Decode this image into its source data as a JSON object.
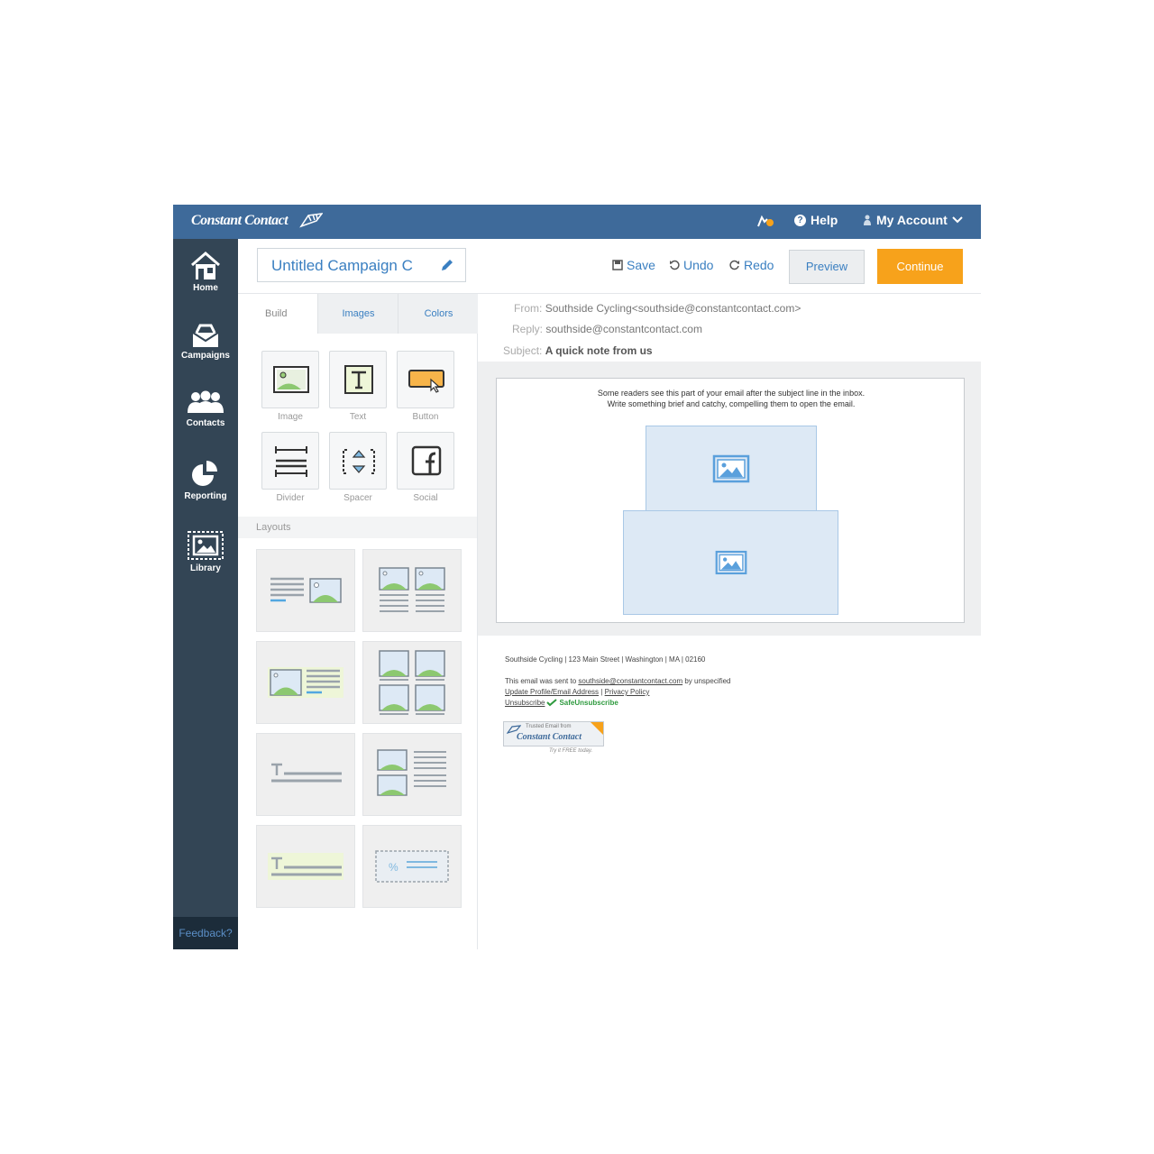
{
  "brand": {
    "name": "Constant Contact",
    "topbar_color": "#3e6a9a",
    "sidebar_color": "#334555",
    "accent": "#f7a21b",
    "link": "#3a7fc1"
  },
  "topbar": {
    "help_label": "Help",
    "account_label": "My Account"
  },
  "sidebar": {
    "items": [
      {
        "label": "Home",
        "icon": "home-icon"
      },
      {
        "label": "Campaigns",
        "icon": "campaigns-icon"
      },
      {
        "label": "Contacts",
        "icon": "contacts-icon"
      },
      {
        "label": "Reporting",
        "icon": "reporting-icon"
      },
      {
        "label": "Library",
        "icon": "library-icon"
      }
    ],
    "feedback_label": "Feedback?"
  },
  "editor": {
    "campaign_title": "Untitled Campaign C",
    "save_label": "Save",
    "undo_label": "Undo",
    "redo_label": "Redo",
    "preview_label": "Preview",
    "continue_label": "Continue"
  },
  "panel": {
    "tabs": [
      {
        "label": "Build"
      },
      {
        "label": "Images"
      },
      {
        "label": "Colors"
      }
    ],
    "blocks": [
      {
        "label": "Image",
        "icon": "image-block-icon"
      },
      {
        "label": "Text",
        "icon": "text-block-icon"
      },
      {
        "label": "Button",
        "icon": "button-block-icon"
      },
      {
        "label": "Divider",
        "icon": "divider-block-icon"
      },
      {
        "label": "Spacer",
        "icon": "spacer-block-icon"
      },
      {
        "label": "Social",
        "icon": "social-block-icon"
      }
    ],
    "layouts_label": "Layouts"
  },
  "email_header": {
    "from_key": "From:",
    "from_value": "Southside Cycling<southside@constantcontact.com>",
    "reply_key": "Reply:",
    "reply_value": "southside@constantcontact.com",
    "subject_key": "Subject:",
    "subject_value": "A quick note from us"
  },
  "email_body": {
    "preheader_line1": "Some readers see this part of your email after the subject line in the inbox.",
    "preheader_line2": "Write something brief and catchy, compelling them to open the email."
  },
  "email_footer": {
    "address": "Southside Cycling | 123 Main Street | Washington | MA | 02160",
    "sent_prefix": "This email was sent to",
    "sent_email": "southside@constantcontact.com",
    "sent_suffix": "by unspecified",
    "update_link": "Update Profile/Email Address",
    "separator": "|",
    "privacy_link": "Privacy Policy",
    "unsubscribe_link": "Unsubscribe",
    "safe_label": "SafeUnsubscribe",
    "badge_line1": "Trusted Email from",
    "badge_brand": "Constant Contact",
    "badge_try": "Try it FREE today."
  }
}
